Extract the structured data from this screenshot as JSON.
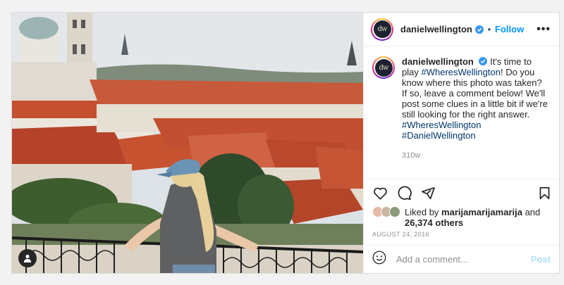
{
  "post": {
    "username": "danielwellington",
    "avatar_initials": "dw",
    "follow_label": "Follow",
    "separator": "•",
    "more_label": "•••",
    "caption": {
      "username": "danielwellington",
      "text_1": "It's time to play",
      "hashtag_1": "#WheresWellington",
      "text_2": "! Do you know where this photo was taken? If so, leave a comment below! We'll post some clues in a little bit if we're still looking for the right answer.",
      "hashtag_2": "#WheresWellington",
      "hashtag_3": "#DanielWellington"
    },
    "age": "310w",
    "likes": {
      "prefix": "Liked by",
      "user": "marijamarijamarija",
      "and": "and",
      "others": "26,374 others"
    },
    "date": "AUGUST 24, 2016",
    "comment": {
      "placeholder": "Add a comment...",
      "post_label": "Post"
    }
  },
  "icons": [
    "user-tag-icon",
    "verified-icon",
    "heart-icon",
    "comment-icon",
    "share-icon",
    "bookmark-icon",
    "emoji-icon"
  ],
  "colors": {
    "link_blue": "#0095f6",
    "hashtag": "#00376b",
    "muted": "#8e8e8e",
    "post_disabled": "#b2dffc",
    "verified": "#3897f0"
  }
}
